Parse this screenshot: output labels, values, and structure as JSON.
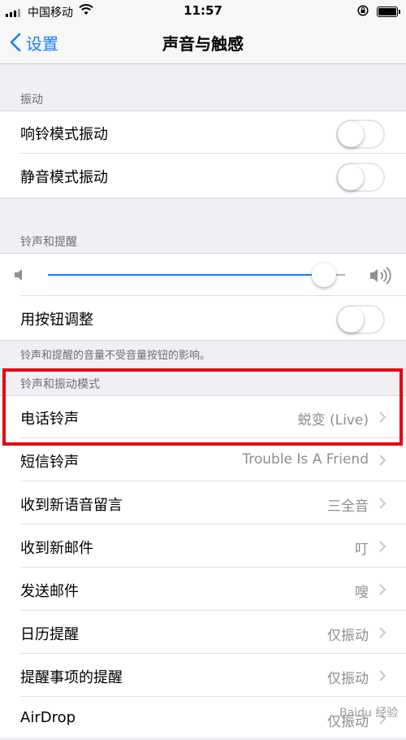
{
  "status": {
    "carrier": "中国移动",
    "time": "11:57"
  },
  "nav": {
    "back_label": "设置",
    "title": "声音与触感"
  },
  "vibration": {
    "header": "振动",
    "rows": [
      {
        "label": "响铃模式振动",
        "on": false
      },
      {
        "label": "静音模式振动",
        "on": false
      }
    ]
  },
  "ringer": {
    "header": "铃声和提醒",
    "volume_level": 0.93,
    "change_with_buttons": {
      "label": "用按钮调整",
      "on": false
    },
    "footer": "铃声和提醒的音量不受音量按钮的影响。"
  },
  "patterns": {
    "header": "铃声和振动模式",
    "rows": [
      {
        "label": "电话铃声",
        "value": "蜕变 (Live)"
      },
      {
        "label": "短信铃声",
        "value": "Trouble Is A Friend"
      },
      {
        "label": "收到新语音留言",
        "value": "三全音"
      },
      {
        "label": "收到新邮件",
        "value": "叮"
      },
      {
        "label": "发送邮件",
        "value": "嗖"
      },
      {
        "label": "日历提醒",
        "value": "仅振动"
      },
      {
        "label": "提醒事项的提醒",
        "value": "仅振动"
      },
      {
        "label": "AirDrop",
        "value": "仅振动"
      }
    ]
  },
  "colors": {
    "accent": "#157efb",
    "highlight_box": "#e60012"
  },
  "watermark": "Baidu 经验"
}
